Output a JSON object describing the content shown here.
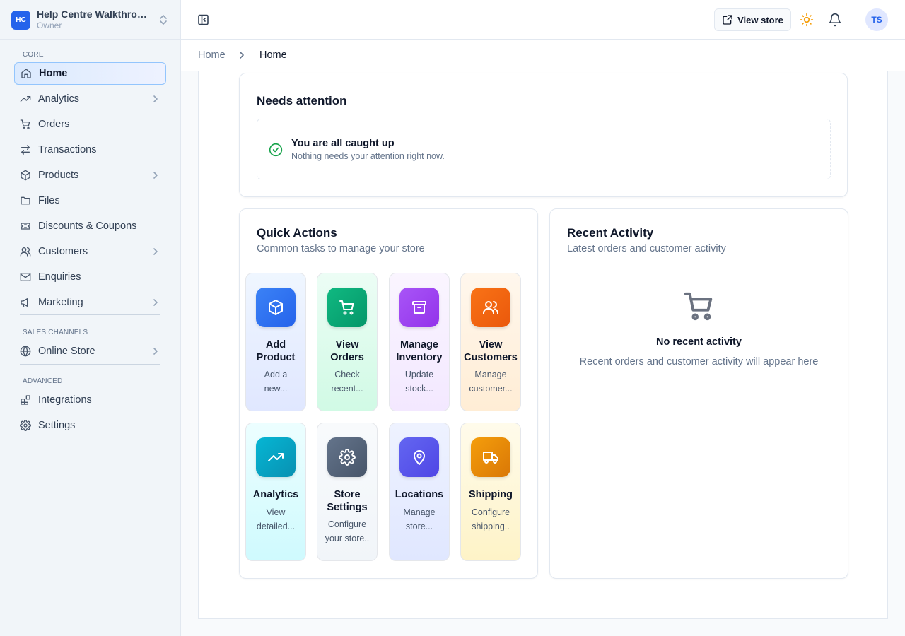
{
  "sidebar": {
    "brand": {
      "initials": "HC",
      "name": "Help Centre Walkthrough",
      "role": "Owner"
    },
    "sections": {
      "core": "CORE",
      "sales_channels": "SALES CHANNELS",
      "advanced": "ADVANCED"
    },
    "items": {
      "home": "Home",
      "analytics": "Analytics",
      "orders": "Orders",
      "transactions": "Transactions",
      "products": "Products",
      "files": "Files",
      "discounts": "Discounts & Coupons",
      "customers": "Customers",
      "enquiries": "Enquiries",
      "marketing": "Marketing",
      "online_store": "Online Store",
      "integrations": "Integrations",
      "settings": "Settings"
    }
  },
  "topbar": {
    "view_store_label": "View store",
    "avatar_initials": "TS"
  },
  "breadcrumb": {
    "home": "Home",
    "current": "Home"
  },
  "needs_attention": {
    "title": "Needs attention",
    "status_title": "You are all caught up",
    "status_subtitle": "Nothing needs your attention right now."
  },
  "quick_actions": {
    "title": "Quick Actions",
    "subtitle": "Common tasks to manage your store",
    "tiles": [
      {
        "name": "Add Product",
        "desc": "Add a new...",
        "icon": "package-icon",
        "color": "#3b82f6"
      },
      {
        "name": "View Orders",
        "desc": "Check recent...",
        "icon": "cart-icon",
        "color": "#10b981"
      },
      {
        "name": "Manage Inventory",
        "desc": "Update stock...",
        "icon": "archive-icon",
        "color": "#a855f7"
      },
      {
        "name": "View Customers",
        "desc": "Manage customer...",
        "icon": "users-icon",
        "color": "#f97316"
      },
      {
        "name": "Analytics",
        "desc": "View detailed...",
        "icon": "trending-up-icon",
        "color": "#06b6d4"
      },
      {
        "name": "Store Settings",
        "desc": "Configure your store..",
        "icon": "gear-icon",
        "color": "#64748b"
      },
      {
        "name": "Locations",
        "desc": "Manage store...",
        "icon": "map-pin-icon",
        "color": "#6366f1"
      },
      {
        "name": "Shipping",
        "desc": "Configure shipping..",
        "icon": "truck-icon",
        "color": "#f59e0b"
      }
    ]
  },
  "recent_activity": {
    "title": "Recent Activity",
    "subtitle": "Latest orders and customer activity",
    "empty_title": "No recent activity",
    "empty_subtitle": "Recent orders and customer activity will appear here"
  }
}
